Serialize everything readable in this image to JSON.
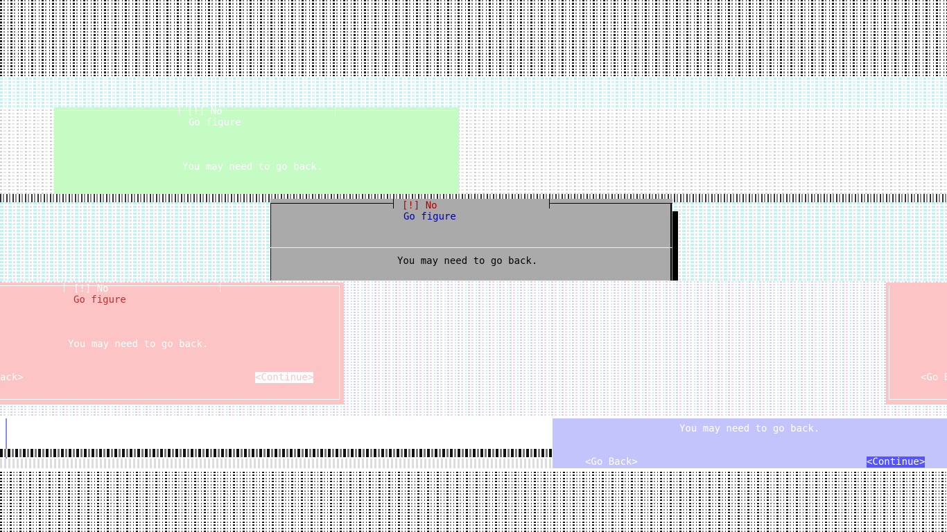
{
  "dialog_main": {
    "title": "[!] No",
    "subtitle": "Go figure",
    "message": "You may need to go back."
  },
  "ghost_green": {
    "title": "[!] No",
    "subtitle": "Go figure",
    "message": "You may need to go back."
  },
  "ghost_red_left": {
    "title": "[!] No",
    "subtitle": "Go figure",
    "message": "You may need to go back.",
    "back_label": "ack>",
    "continue_label": "<Continue>"
  },
  "ghost_red_right": {
    "back_label": "<Go B"
  },
  "ghost_blue": {
    "message": "You may need to go back.",
    "back_label": "<Go Back>",
    "continue_label": "<Continue>"
  },
  "colors": {
    "main_bg": "#aaaaaa",
    "title_red": "#b00000",
    "subtitle_blue": "#0000a8",
    "green_ghost": "#c4fcc4",
    "red_ghost": "#fcc4c4",
    "blue_ghost": "#c4c4fc",
    "ghost_text": "#ffffff",
    "noise_dark": "#1a1a1a",
    "noise_cyan": "#bff3ef"
  }
}
